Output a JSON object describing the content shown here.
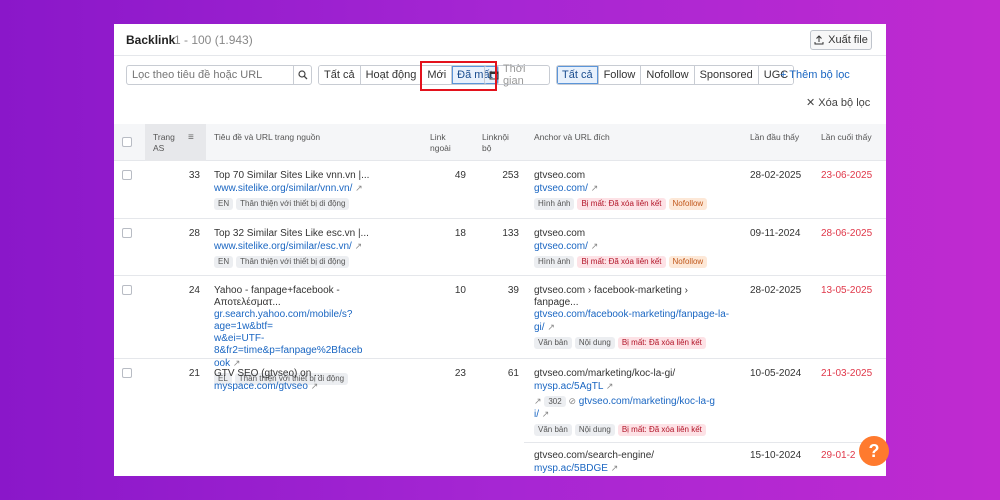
{
  "header": {
    "title": "Backlink",
    "count": "1 - 100 (1.943)",
    "export_label": "Xuất file"
  },
  "search": {
    "placeholder": "Lọc theo tiêu đề hoặc URL"
  },
  "status_tabs": [
    "Tất cả",
    "Hoạt động",
    "Mới",
    "Đã mất"
  ],
  "time_label": "Thời gian",
  "type_tabs": [
    "Tất cả",
    "Follow",
    "Nofollow",
    "Sponsored",
    "UGC"
  ],
  "add_filter": "+ Thêm bộ lọc",
  "clear_filter": "Xóa bộ lọc",
  "columns": {
    "as_1": "Trang",
    "as_2": "AS",
    "source": "Tiêu đề và URL trang nguồn",
    "ext_1": "Link",
    "ext_2": "ngoài",
    "int_1": "Linknội",
    "int_2": "bộ",
    "anchor": "Anchor và URL đích",
    "first": "Lần đầu thấy",
    "last": "Lần cuối thấy"
  },
  "rows": [
    {
      "as": "33",
      "title": "Top 70 Similar Sites Like vnn.vn |...",
      "url": "www.sitelike.org/similar/vnn.vn/",
      "lang": "EN",
      "device": "Thân thiện với thiết bị di động",
      "ext": "49",
      "int": "253",
      "anchor": "gtvseo.com",
      "anchor_url": "gtvseo.com/",
      "t1": "Hình ảnh",
      "t2": "Bị mất: Đã xóa liên kết",
      "t3": "Nofollow",
      "first": "28-02-2025",
      "last": "23-06-2025"
    },
    {
      "as": "28",
      "title": "Top 32 Similar Sites Like esc.vn |...",
      "url": "www.sitelike.org/similar/esc.vn/",
      "lang": "EN",
      "device": "Thân thiện với thiết bị di động",
      "ext": "18",
      "int": "133",
      "anchor": "gtvseo.com",
      "anchor_url": "gtvseo.com/",
      "t1": "Hình ảnh",
      "t2": "Bị mất: Đã xóa liên kết",
      "t3": "Nofollow",
      "first": "09-11-2024",
      "last": "28-06-2025"
    },
    {
      "as": "24",
      "title": "Yahoo - fanpage+facebook - Αποτελέσματ...",
      "url_1": "gr.search.yahoo.com/mobile/s?age=1w&btf=",
      "url_2": "w&ei=UTF-8&fr2=time&p=fanpage%2Bfaceb",
      "url_3": "ook",
      "lang": "EL",
      "device": "Thân thiện với thiết bị di động",
      "ext": "10",
      "int": "39",
      "anchor": "gtvseo.com › facebook-marketing › fanpage...",
      "anchor_url_1": "gtvseo.com/facebook-marketing/fanpage-la-",
      "anchor_url_2": "gi/",
      "t1": "Văn bản",
      "t2": "Nội dung",
      "t3": "Bị mất: Đã xóa liên kết",
      "first": "28-02-2025",
      "last": "13-05-2025"
    },
    {
      "as": "21",
      "title": "GTV SEO (gtvseo) on ...",
      "url": "myspace.com/gtvseo",
      "ext": "23",
      "int": "61",
      "anchor": "gtvseo.com/marketing/koc-la-gi/",
      "anchor_url": "mysp.ac/5AgTL",
      "redirect_code": "302",
      "redirect_1": "gtvseo.com/marketing/koc-la-g",
      "redirect_2": "i/",
      "t1": "Văn bản",
      "t2": "Nội dung",
      "t3": "Bị mất: Đã xóa liên kết",
      "first": "10-05-2024",
      "last": "21-03-2025",
      "anchor_b": "gtvseo.com/search-engine/",
      "anchor_b_url": "mysp.ac/5BDGE",
      "first_b": "15-10-2024",
      "last_b": "29-01-2"
    }
  ],
  "help_label": "?"
}
